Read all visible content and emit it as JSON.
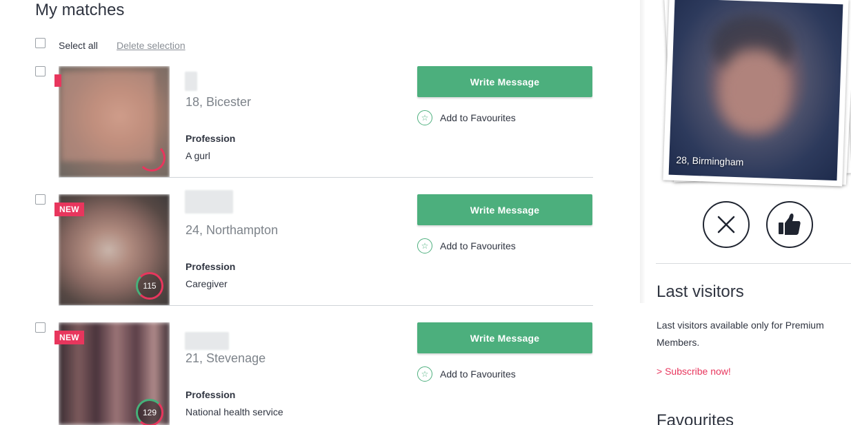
{
  "page": {
    "title": "My matches"
  },
  "toolbar": {
    "select_all_label": "Select all",
    "delete_label": "Delete selection"
  },
  "matches": [
    {
      "new_badge": "",
      "age_city": "18, Bicester",
      "profession_label": "Profession",
      "profession": "A gurl",
      "score": "",
      "write_label": "Write Message",
      "fav_label": "Add to Favourites"
    },
    {
      "new_badge": "NEW",
      "age_city": "24, Northampton",
      "profession_label": "Profession",
      "profession": "Caregiver",
      "score": "115",
      "write_label": "Write Message",
      "fav_label": "Add to Favourites"
    },
    {
      "new_badge": "NEW",
      "age_city": "21, Stevenage",
      "profession_label": "Profession",
      "profession": "National health service",
      "score": "129",
      "write_label": "Write Message",
      "fav_label": "Add to Favourites"
    }
  ],
  "sidebar": {
    "card_caption": "28, Birmingham",
    "last_visitors": {
      "title": "Last visitors",
      "note": "Last visitors available only for Premium Members.",
      "subscribe": "> Subscribe now!"
    },
    "favourites_title": "Favourites"
  },
  "colors": {
    "accent_green": "#4caf7d",
    "accent_pink": "#e8365d",
    "text": "#2f3440",
    "muted": "#7d838a"
  },
  "icons": {
    "favourite": "star-icon",
    "dislike": "close-icon",
    "like": "thumbs-up-icon"
  }
}
